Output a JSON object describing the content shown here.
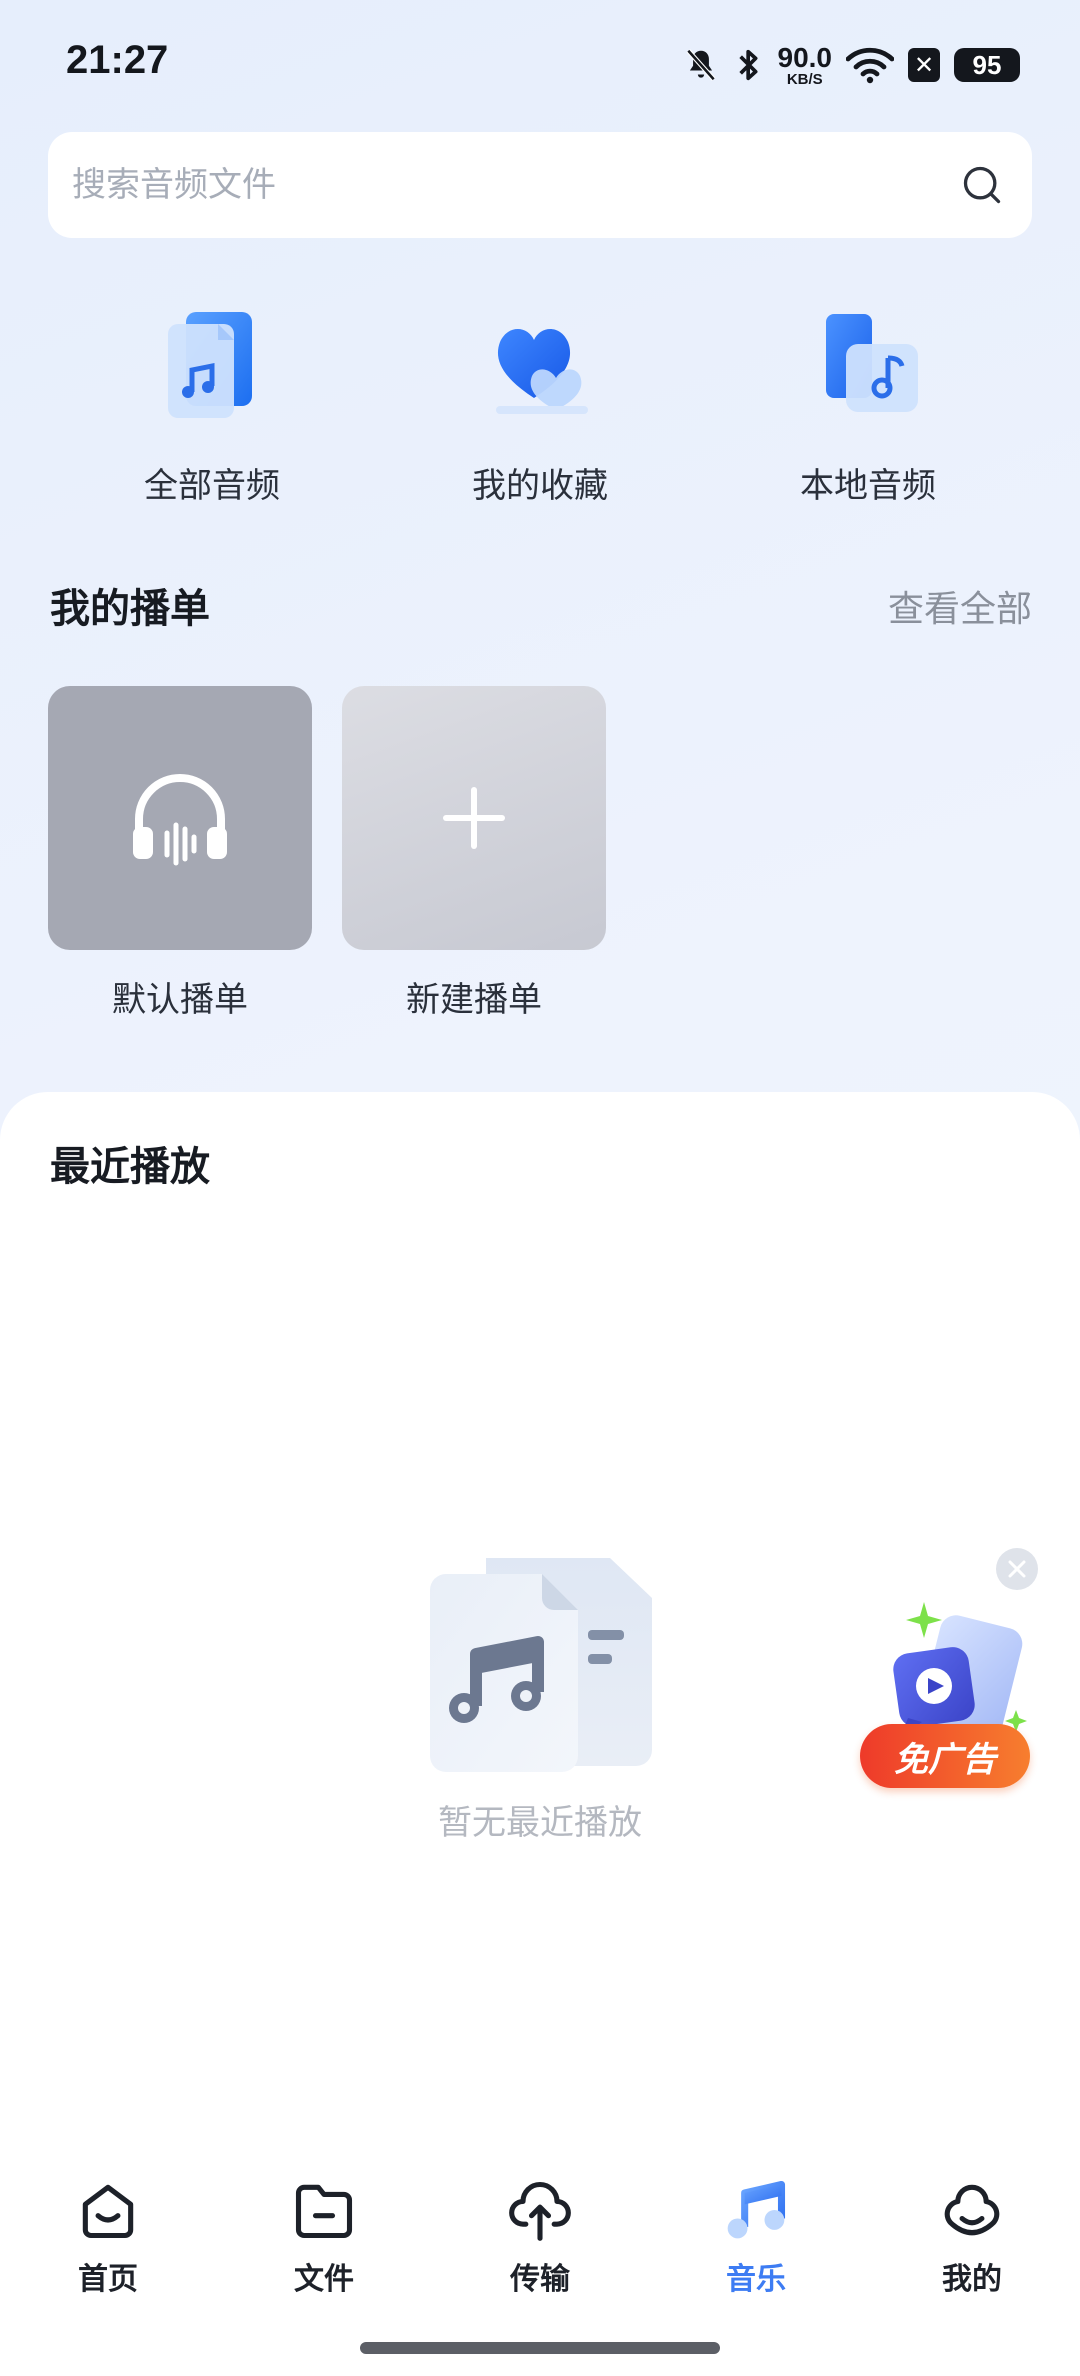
{
  "status": {
    "time": "21:27",
    "net_speed_value": "90.0",
    "net_speed_unit": "KB/S",
    "battery": "95",
    "icons": [
      "mute-bell-icon",
      "bluetooth-icon",
      "wifi-icon",
      "x-app-icon"
    ]
  },
  "search": {
    "placeholder": "搜索音频文件"
  },
  "quick_entries": [
    {
      "label": "全部音频",
      "icon": "all-audio-icon"
    },
    {
      "label": "我的收藏",
      "icon": "favorites-hearts-icon"
    },
    {
      "label": "本地音频",
      "icon": "local-audio-icon"
    }
  ],
  "playlists": {
    "title": "我的播单",
    "see_all": "查看全部",
    "items": [
      {
        "label": "默认播单",
        "icon": "headphones-icon"
      },
      {
        "label": "新建播单",
        "icon": "plus-icon"
      }
    ]
  },
  "recent": {
    "title": "最近播放",
    "empty_text": "暂无最近播放"
  },
  "ad": {
    "badge": "免广告"
  },
  "nav": {
    "items": [
      {
        "label": "首页",
        "icon": "home-icon",
        "active": false
      },
      {
        "label": "文件",
        "icon": "folder-icon",
        "active": false
      },
      {
        "label": "传输",
        "icon": "transfer-cloud-icon",
        "active": false
      },
      {
        "label": "音乐",
        "icon": "music-note-icon",
        "active": true
      },
      {
        "label": "我的",
        "icon": "profile-icon",
        "active": false
      }
    ]
  },
  "colors": {
    "accent": "#3d7cf3",
    "ad_start": "#ee3a2a",
    "ad_end": "#f77e2e"
  }
}
